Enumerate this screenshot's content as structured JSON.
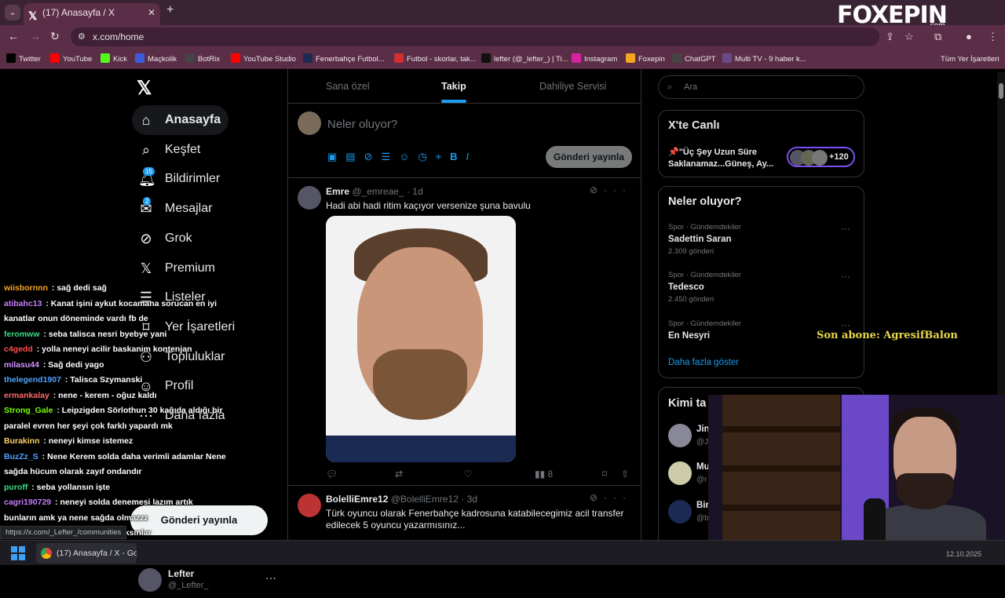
{
  "browser": {
    "tab_title": "(17) Anasayfa / X",
    "url": "x.com/home",
    "logo": "FOXEPIN",
    "logo_sub": ".com",
    "bookmarks": [
      {
        "label": "Twitter",
        "color": "#000000"
      },
      {
        "label": "YouTube",
        "color": "#ff0000"
      },
      {
        "label": "Kick",
        "color": "#53fc18"
      },
      {
        "label": "Maçkolik",
        "color": "#3b5bdb"
      },
      {
        "label": "BotRix",
        "color": "#444444"
      },
      {
        "label": "YouTube Studio",
        "color": "#ff0000"
      },
      {
        "label": "Fenerbahçe Futbol...",
        "color": "#1b2a52"
      },
      {
        "label": "Futbol - skorlar, tak...",
        "color": "#d32f2f"
      },
      {
        "label": "lefter (@_lefter_) | Ti...",
        "color": "#111111"
      },
      {
        "label": "Instagram",
        "color": "#d6249f"
      },
      {
        "label": "Foxepin",
        "color": "#f5a623"
      },
      {
        "label": "ChatGPT",
        "color": "#444444"
      },
      {
        "label": "Multi TV - 9 haber k...",
        "color": "#6a4a8a"
      },
      {
        "label": "Tüm Yer İşaretleri",
        "color": "#5b2e48"
      }
    ]
  },
  "nav": {
    "items": [
      {
        "label": "Anasayfa",
        "icon": "home-icon"
      },
      {
        "label": "Keşfet",
        "icon": "search-icon"
      },
      {
        "label": "Bildirimler",
        "icon": "bell-icon",
        "badge": "15"
      },
      {
        "label": "Mesajlar",
        "icon": "mail-icon",
        "badge": "2"
      },
      {
        "label": "Grok",
        "icon": "grok-icon"
      },
      {
        "label": "Premium",
        "icon": "x-icon"
      },
      {
        "label": "Listeler",
        "icon": "list-icon"
      },
      {
        "label": "Yer İşaretleri",
        "icon": "bookmark-icon"
      },
      {
        "label": "Topluluklar",
        "icon": "communities-icon"
      },
      {
        "label": "Profil",
        "icon": "profile-icon"
      },
      {
        "label": "Daha fazla",
        "icon": "more-icon"
      }
    ],
    "post_button": "Gönderi yayınla",
    "profile_name": "Lefter",
    "profile_handle": "@_Lefter_"
  },
  "status_url": "https://x.com/_Lefter_/communities",
  "chat": [
    {
      "user": "wiisbornnn",
      "color": "#f5a623",
      "text": "sağ dedi sağ"
    },
    {
      "user": "atibahc13",
      "color": "#c77dff",
      "text": "Kanat işini aykut kocamana sorucan en iyi kanatlar onun döneminde vardı fb de"
    },
    {
      "user": "feromww",
      "color": "#3ddc84",
      "text": "seba talisca nesri byebye yani"
    },
    {
      "user": "c4gedd",
      "color": "#ff4d4d",
      "text": "yolla neneyi acilir baskanim kontenjan"
    },
    {
      "user": "milasu44",
      "color": "#d291ff",
      "text": "Sağ dedi yago"
    },
    {
      "user": "thelegend1907",
      "color": "#4da3ff",
      "text": "Talisca Szymanski"
    },
    {
      "user": "ermankalay",
      "color": "#ff6b6b",
      "text": "nene - kerem - oğuz kaldı"
    },
    {
      "user": "Strong_Gale",
      "color": "#7cfc00",
      "text": "Leipzigden Sörlothun 30 kağıda aldığı bir paralel evren her şeyi çok farklı yapardı mk"
    },
    {
      "user": "Burakinn",
      "color": "#ffd166",
      "text": "neneyi kimse istemez"
    },
    {
      "user": "BuzZz_S",
      "color": "#4da3ff",
      "text": "Nene Kerem solda daha verimli adamlar Nene sağda hücum olarak zayıf ondandır"
    },
    {
      "user": "puroff",
      "color": "#3ddc84",
      "text": "seba yollansın işte"
    },
    {
      "user": "cagri190729",
      "color": "#c77dff",
      "text": "neneyi solda denemesi lazım artık bunların amk ya nene sağda olmazzz"
    },
    {
      "user": "kaankalkan_06",
      "color": "#ffd166",
      "text": "caglarıda bıraksınlar"
    }
  ],
  "feed": {
    "tabs": [
      "Sana özel",
      "Takip",
      "Dahiliye Servisi"
    ],
    "compose_placeholder": "Neler oluyor?",
    "compose_button": "Gönderi yayınla",
    "tweets": [
      {
        "name": "Emre",
        "handle": "@_emreae_",
        "time": "· 1d",
        "text": "Hadi abi hadi ritim kaçıyor versenize şuna bavulu",
        "views": "8"
      },
      {
        "name": "BolelliEmre12",
        "handle": "@BolelliEmre12",
        "time": "· 3d",
        "text": "Türk oyuncu olarak Fenerbahçe kadrosuna katabilecegimiz acil transfer edilecek 5 oyuncu yazarmısınız..."
      }
    ]
  },
  "sidebar": {
    "search_placeholder": "Ara",
    "live_title": "X'te Canlı",
    "live_text": "📌\"Üç Şey Uzun Süre Saklanamaz...Güneş, Ay...",
    "live_count": "+120",
    "trends_title": "Neler oluyor?",
    "trends": [
      {
        "category": "Spor · Gündemdekiler",
        "name": "Sadettin Saran",
        "posts": "2.309 gönderi"
      },
      {
        "category": "Spor · Gündemdekiler",
        "name": "Tedesco",
        "posts": "2.450 gönderi"
      },
      {
        "category": "Spor · Gündemdekiler",
        "name": "En Nesyri",
        "posts": ""
      }
    ],
    "show_more": "Daha fazla göster",
    "who_title": "Kimi ta",
    "who": [
      {
        "name": "Jin",
        "handle": "@J"
      },
      {
        "name": "Mu",
        "handle": "@r"
      },
      {
        "name": "Bir",
        "handle": "@b"
      }
    ]
  },
  "overlay": {
    "last_sub": "Son abone: AgresifBalon"
  },
  "taskbar": {
    "app": "(17) Anasayfa / X - Goog",
    "clock": "12.10.2025"
  }
}
